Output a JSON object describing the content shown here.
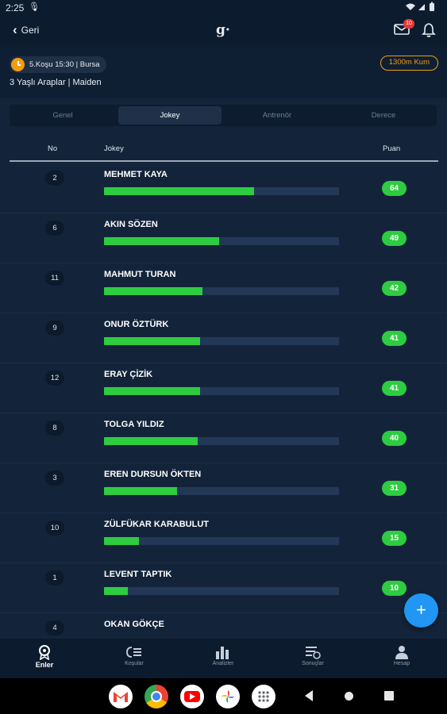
{
  "status_bar": {
    "time": "2:25"
  },
  "header": {
    "back_label": "Geri",
    "logo": "g·",
    "mail_badge": "10"
  },
  "race": {
    "pill": "5.Koşu 15:30 | Bursa",
    "subtitle": "3 Yaşlı Araplar | Maiden",
    "track": "1300m Kum"
  },
  "tabs": [
    {
      "label": "Genel"
    },
    {
      "label": "Jokey"
    },
    {
      "label": "Antrenör"
    },
    {
      "label": "Derece"
    }
  ],
  "table": {
    "headers": {
      "no": "No",
      "jockey": "Jokey",
      "score": "Puan"
    },
    "rows": [
      {
        "no": "2",
        "name": "MEHMET KAYA",
        "score": "64",
        "bar_fraction": 0.64
      },
      {
        "no": "6",
        "name": "AKIN SÖZEN",
        "score": "49",
        "bar_fraction": 0.49
      },
      {
        "no": "11",
        "name": "MAHMUT TURAN",
        "score": "42",
        "bar_fraction": 0.42
      },
      {
        "no": "9",
        "name": "ONUR ÖZTÜRK",
        "score": "41",
        "bar_fraction": 0.41
      },
      {
        "no": "12",
        "name": "ERAY ÇİZİK",
        "score": "41",
        "bar_fraction": 0.41
      },
      {
        "no": "8",
        "name": "TOLGA YILDIZ",
        "score": "40",
        "bar_fraction": 0.4
      },
      {
        "no": "3",
        "name": "EREN DURSUN ÖKTEN",
        "score": "31",
        "bar_fraction": 0.31
      },
      {
        "no": "10",
        "name": "ZÜLFÜKAR KARABULUT",
        "score": "15",
        "bar_fraction": 0.15
      },
      {
        "no": "1",
        "name": "LEVENT TAPTIK",
        "score": "10",
        "bar_fraction": 0.1
      },
      {
        "no": "4",
        "name": "OKAN GÖKÇE",
        "score": "",
        "bar_fraction": 0
      }
    ]
  },
  "bottom_nav": [
    {
      "label": "Enler",
      "icon": "medal-icon"
    },
    {
      "label": "Koşular",
      "icon": "races-icon"
    },
    {
      "label": "Analizler",
      "icon": "bar-chart-icon"
    },
    {
      "label": "Sonuçlar",
      "icon": "results-list-icon"
    },
    {
      "label": "Hesap",
      "icon": "person-icon"
    }
  ],
  "colors": {
    "accent_green": "#2ecc40",
    "accent_orange": "#f39c12",
    "fab_blue": "#2196f3",
    "bg": "#13243a"
  }
}
